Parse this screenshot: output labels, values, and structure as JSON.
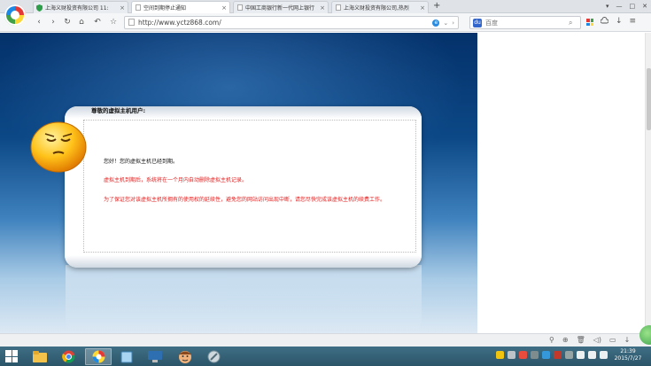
{
  "browser": {
    "tabs": [
      {
        "title": "上海义财投资有限公司 11:",
        "icon": "shield-icon",
        "active": false
      },
      {
        "title": "空间到期停止通知",
        "icon": "page-icon",
        "active": true
      },
      {
        "title": "中国工商银行新一代网上银行",
        "icon": "page-icon",
        "active": false
      },
      {
        "title": "上海义财投资有限公司,热烈",
        "icon": "page-icon",
        "active": false
      }
    ],
    "tab_close": "×",
    "new_tab": "+",
    "window_controls": [
      "▾",
      "—",
      "□",
      "✕"
    ],
    "nav": {
      "back": "‹",
      "forward": "›",
      "reload": "↻",
      "home": "⌂",
      "undo": "↶",
      "star": "☆"
    },
    "address": {
      "url": "http://www.yctz868.com/"
    },
    "search": {
      "placeholder": "百度",
      "engine": "du"
    }
  },
  "page": {
    "greeting": "尊敬的虚拟主机用户:",
    "line1": "您好！您的虚拟主机已经到期。",
    "line2": "虚拟主机到期后，系统将在一个月内自动删除虚拟主机记录。",
    "line3": "为了保证您对该虚拟主机所拥有的使用权的延续性，避免您的网站访问出现中断，请您尽快完成该虚拟主机的续费工作。"
  },
  "taskbar": {
    "clock_time": "21:39",
    "clock_date": "2015/7/27"
  },
  "colors": {
    "notice_red": "#e02020",
    "page_blue_dark": "#04316a",
    "taskbar": "#2b5468"
  }
}
